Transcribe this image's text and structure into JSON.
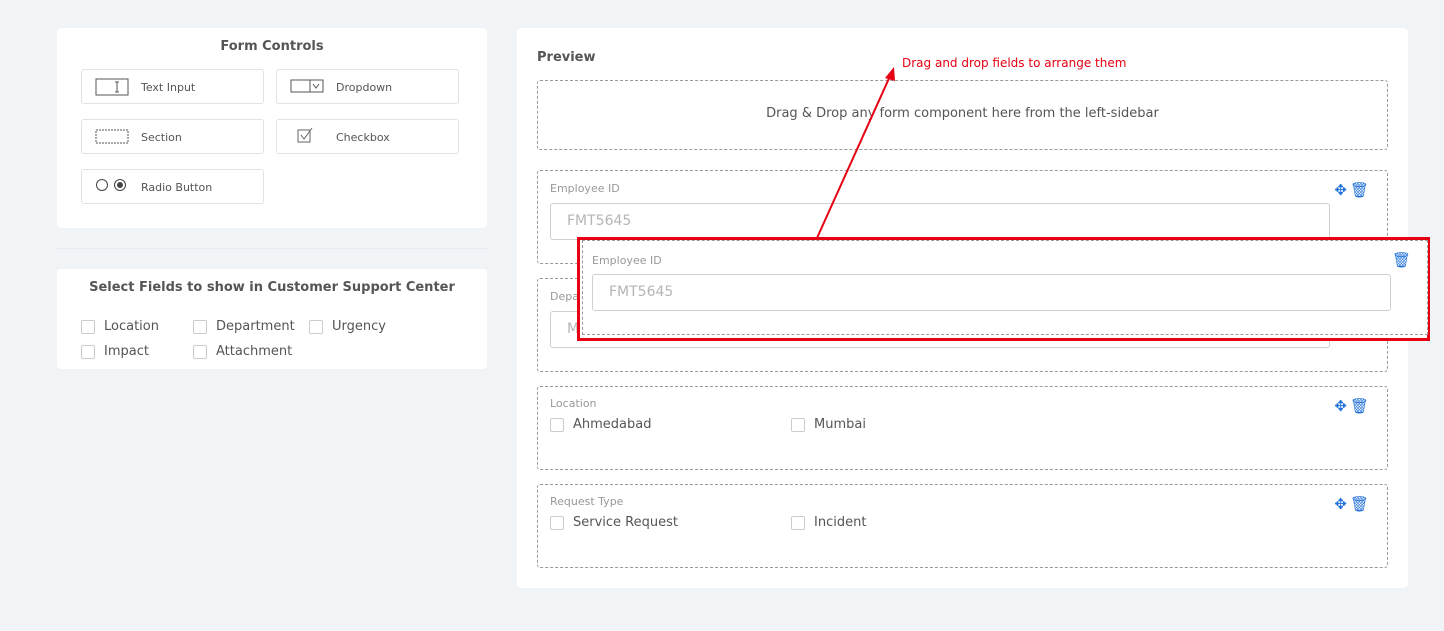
{
  "form_controls": {
    "title": "Form Controls",
    "items": [
      {
        "label": "Text Input",
        "icon": "text-input-icon"
      },
      {
        "label": "Dropdown",
        "icon": "dropdown-icon"
      },
      {
        "label": "Section",
        "icon": "section-icon"
      },
      {
        "label": "Checkbox",
        "icon": "checkbox-icon"
      },
      {
        "label": "Radio Button",
        "icon": "radio-button-icon"
      }
    ]
  },
  "select_fields": {
    "title": "Select Fields to show in Customer Support Center",
    "options": [
      "Location",
      "Department",
      "Urgency",
      "Impact",
      "Attachment"
    ]
  },
  "preview": {
    "title": "Preview",
    "dropzone_text": "Drag & Drop any form component here from the left-sidebar",
    "fields": {
      "employee_id": {
        "label": "Employee ID",
        "placeholder": "FMT5645"
      },
      "department": {
        "label": "Department",
        "placeholder": "M"
      },
      "location": {
        "label": "Location",
        "options": [
          "Ahmedabad",
          "Mumbai"
        ]
      },
      "request_type": {
        "label": "Request Type",
        "options": [
          "Service Request",
          "Incident"
        ]
      }
    },
    "dragged_field": {
      "label": "Employee ID",
      "placeholder": "FMT5645"
    }
  },
  "annotation": {
    "text": "Drag and drop fields to arrange them",
    "color": "#e60012"
  },
  "colors": {
    "accent": "#1e6fd9",
    "highlight": "#e60012"
  }
}
